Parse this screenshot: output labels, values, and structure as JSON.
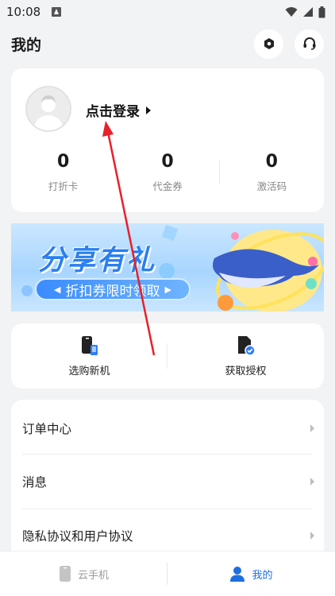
{
  "status_bar": {
    "time": "10:08"
  },
  "header": {
    "title": "我的"
  },
  "profile": {
    "login_label": "点击登录"
  },
  "stats": [
    {
      "value": "0",
      "label": "打折卡"
    },
    {
      "value": "0",
      "label": "代金券"
    },
    {
      "value": "0",
      "label": "激活码"
    }
  ],
  "banner": {
    "title": "分享有礼",
    "pill_text": "折扣券限时领取"
  },
  "actions": [
    {
      "label": "选购新机",
      "icon": "phone-device-icon"
    },
    {
      "label": "获取授权",
      "icon": "document-check-icon"
    }
  ],
  "menu": [
    {
      "label": "订单中心"
    },
    {
      "label": "消息"
    },
    {
      "label": "隐私协议和用户协议"
    }
  ],
  "tabbar": {
    "tabs": [
      {
        "label": "云手机",
        "icon": "cloud-phone-icon",
        "active": false
      },
      {
        "label": "我的",
        "icon": "person-icon",
        "active": true
      }
    ]
  },
  "colors": {
    "accent": "#1f6fe0",
    "annotation_arrow": "#e8202a",
    "banner_title": "#2a7ff0"
  }
}
